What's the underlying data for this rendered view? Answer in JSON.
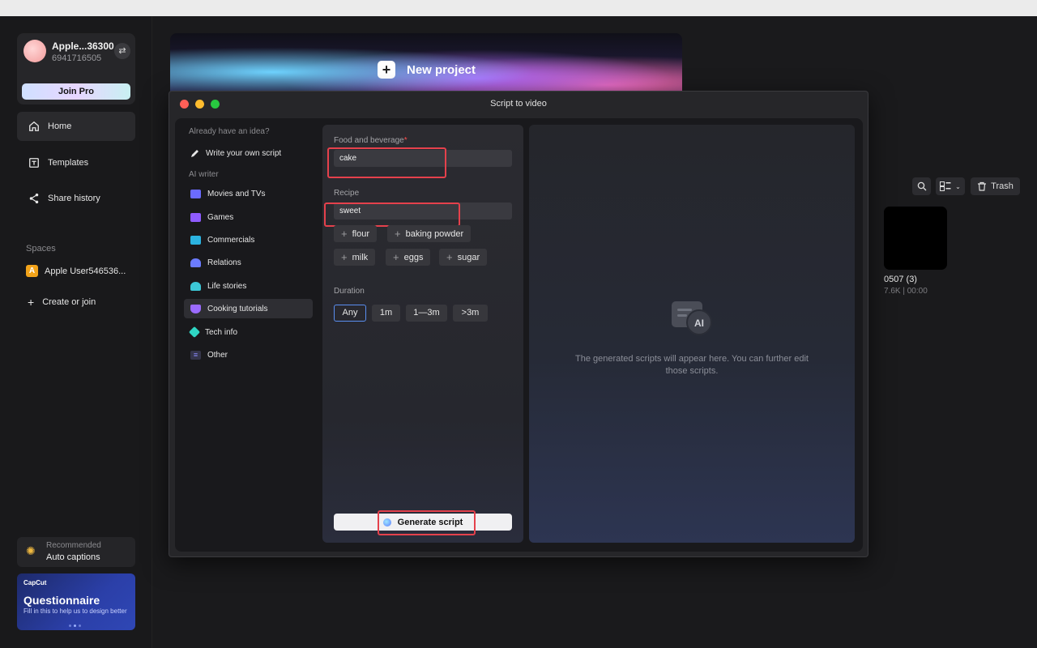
{
  "sidebar": {
    "profile": {
      "name": "Apple...36300",
      "id": "6941716505",
      "join_label": "Join Pro"
    },
    "nav": [
      {
        "label": "Home",
        "icon": "home-icon"
      },
      {
        "label": "Templates",
        "icon": "templates-icon"
      },
      {
        "label": "Share history",
        "icon": "share-icon"
      }
    ],
    "spaces_label": "Spaces",
    "space": {
      "badge": "A",
      "name": "Apple User546536..."
    },
    "create_label": "Create or join",
    "recommended": {
      "small": "Recommended",
      "title": "Auto captions"
    },
    "questionnaire": {
      "logo": "CapCut",
      "title": "Questionnaire",
      "subtitle": "Fill in this to help us to design better"
    }
  },
  "main": {
    "new_project": "New project",
    "trash_label": "Trash",
    "project": {
      "name": "0507 (3)",
      "meta": "7.6K | 00:00"
    }
  },
  "modal": {
    "title": "Script to video",
    "categories_header": "Already have an idea?",
    "write_own": "Write your own script",
    "ai_writer_label": "AI writer",
    "categories": [
      {
        "label": "Movies and TVs",
        "color": "#6b6bff"
      },
      {
        "label": "Games",
        "color": "#8f5bff"
      },
      {
        "label": "Commercials",
        "color": "#2bb3e0"
      },
      {
        "label": "Relations",
        "color": "#6b7bff"
      },
      {
        "label": "Life stories",
        "color": "#3cc7d6"
      },
      {
        "label": "Cooking tutorials",
        "color": "#9b6bff"
      },
      {
        "label": "Tech info",
        "color": "#2fd6c4"
      },
      {
        "label": "Other",
        "color": "#8b8bff"
      }
    ],
    "form": {
      "food_label": "Food and beverage",
      "required_mark": "*",
      "food_value": "cake",
      "recipe_label": "Recipe",
      "recipe_value": "sweet",
      "ingredients": [
        "flour",
        "baking powder",
        "milk",
        "eggs",
        "sugar"
      ],
      "duration_label": "Duration",
      "durations": [
        "Any",
        "1m",
        "1—3m",
        ">3m"
      ],
      "selected_duration": "Any",
      "generate_label": "Generate script"
    },
    "result_placeholder": "The generated scripts will appear here. You can further edit those scripts."
  },
  "colors": {
    "accent": "#5a8ef0",
    "highlight": "#e5414c",
    "close": "#fe5f57",
    "minimize": "#febc2e",
    "maximize": "#28c840"
  }
}
